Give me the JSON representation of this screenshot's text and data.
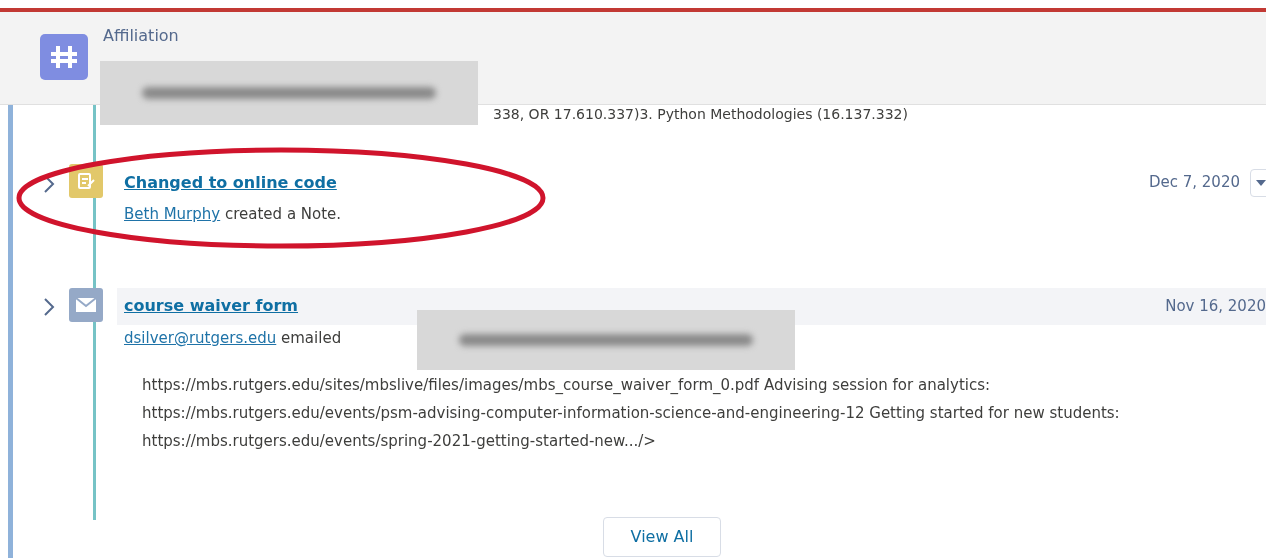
{
  "header": {
    "label": "Affiliation",
    "redacted": true
  },
  "hidden_line": "338, OR 17.610.337)3. Python Methodologies (16.137.332)",
  "items": [
    {
      "kind": "note",
      "title": "Changed to online code",
      "actor": "Beth Murphy",
      "action": "created a Note.",
      "date": "Dec 7, 2020",
      "menu": true,
      "highlighted": false,
      "circled": true
    },
    {
      "kind": "email",
      "title": "course waiver form",
      "actor": "dsilver@rutgers.edu",
      "action": "emailed",
      "date": "Nov 16, 2020",
      "menu": false,
      "highlighted": true,
      "circled": false,
      "recipient_redacted": true,
      "body": "https://mbs.rutgers.edu/sites/mbslive/files/images/mbs_course_waiver_form_0.pdf Advising session for analytics: https://mbs.rutgers.edu/events/psm-advising-computer-information-science-and-engineering-12 Getting started for new students: https://mbs.rutgers.edu/events/spring-2021-getting-started-new.../>"
    }
  ],
  "view_all": "View All"
}
